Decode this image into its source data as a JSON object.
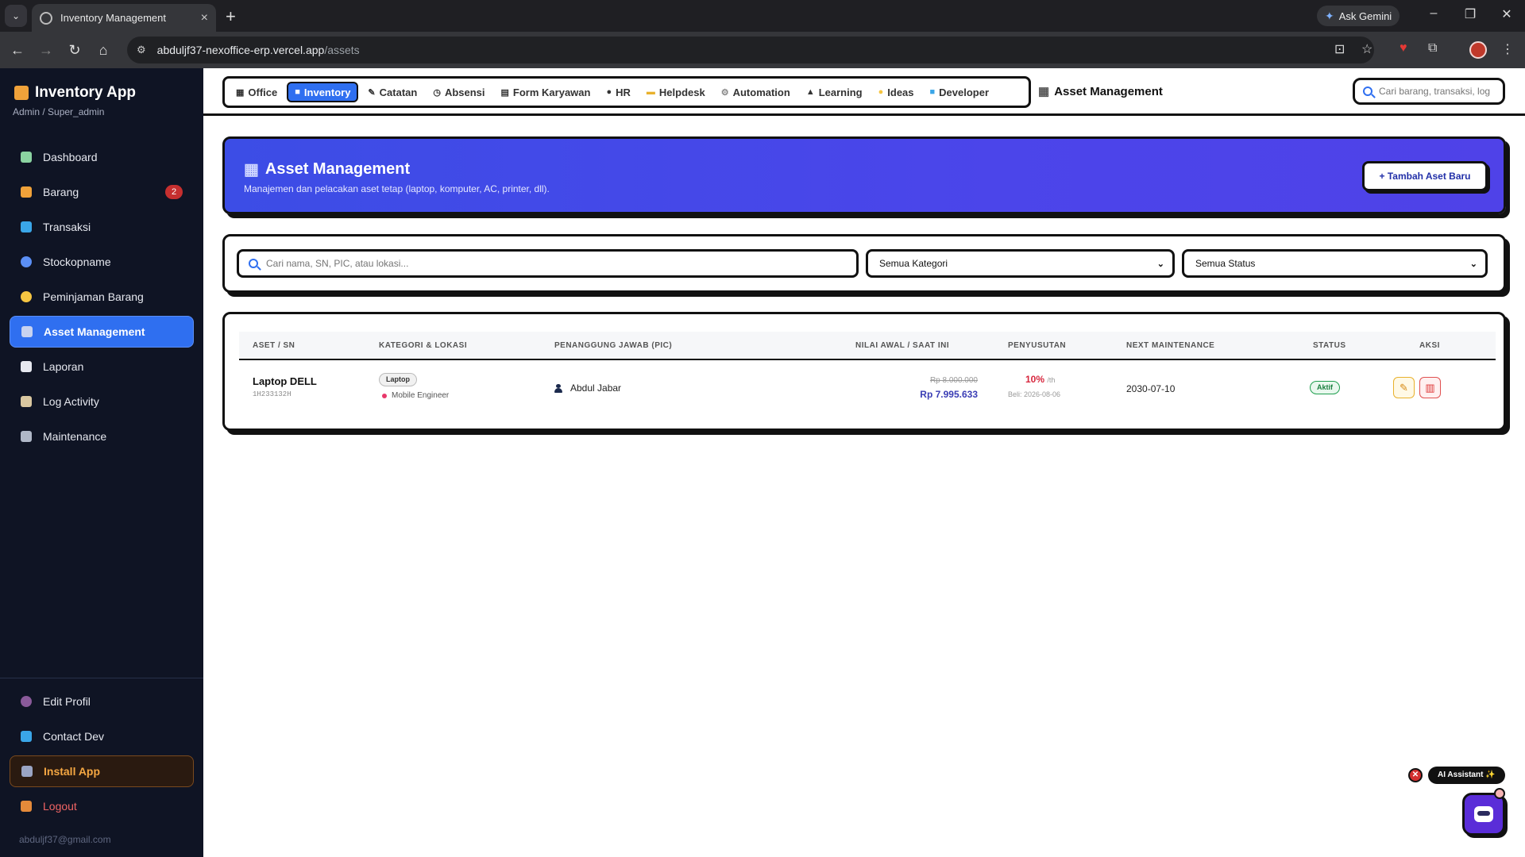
{
  "browser": {
    "tab_title": "Inventory Management",
    "new_tab": "+",
    "gemini_label": "Ask Gemini",
    "url_host": "abduljf37-nexoffice-erp.vercel.app",
    "url_path": "/assets"
  },
  "sidebar": {
    "app_title": "Inventory App",
    "role": "Admin / Super_admin",
    "items": [
      {
        "label": "Dashboard",
        "icon": "dashboard-icon",
        "color": "#8bd3a1"
      },
      {
        "label": "Barang",
        "icon": "box-icon",
        "color": "#f0a23a",
        "badge": "2"
      },
      {
        "label": "Transaksi",
        "icon": "swap-icon",
        "color": "#3aa6e8"
      },
      {
        "label": "Stockopname",
        "icon": "search-icon",
        "color": "#5b8ff5"
      },
      {
        "label": "Peminjaman Barang",
        "icon": "handshake-icon",
        "color": "#f5c542"
      },
      {
        "label": "Asset Management",
        "icon": "building-icon",
        "color": "#c7d2f0",
        "active": true
      },
      {
        "label": "Laporan",
        "icon": "document-icon",
        "color": "#e6e8ef"
      },
      {
        "label": "Log Activity",
        "icon": "clipboard-icon",
        "color": "#d9c7a0"
      },
      {
        "label": "Maintenance",
        "icon": "tools-icon",
        "color": "#b0b8c8"
      }
    ],
    "bottom": [
      {
        "label": "Edit Profil",
        "icon": "user-icon",
        "color": "#8a5a9a"
      },
      {
        "label": "Contact Dev",
        "icon": "info-icon",
        "color": "#3aa6e8"
      },
      {
        "label": "Install App",
        "icon": "install-icon",
        "color": "#9aa5c4"
      },
      {
        "label": "Logout",
        "icon": "door-icon",
        "color": "#e58a3a"
      }
    ],
    "email": "abduljf37@gmail.com"
  },
  "modules": [
    {
      "label": "Office",
      "icon": "building-icon"
    },
    {
      "label": "Inventory",
      "icon": "box-icon",
      "active": true
    },
    {
      "label": "Catatan",
      "icon": "memo-icon"
    },
    {
      "label": "Absensi",
      "icon": "clock-icon"
    },
    {
      "label": "Form Karyawan",
      "icon": "form-icon"
    },
    {
      "label": "HR",
      "icon": "user-icon"
    },
    {
      "label": "Helpdesk",
      "icon": "ticket-icon"
    },
    {
      "label": "Automation",
      "icon": "gear-icon"
    },
    {
      "label": "Learning",
      "icon": "graduation-cap-icon"
    },
    {
      "label": "Ideas",
      "icon": "lightbulb-icon"
    },
    {
      "label": "Developer",
      "icon": "book-icon"
    }
  ],
  "header": {
    "page_title": "Asset Management",
    "search_placeholder": "Cari barang, transaksi, log..."
  },
  "hero": {
    "title": "Asset Management",
    "subtitle": "Manajemen dan pelacakan aset tetap (laptop, komputer, AC, printer, dll).",
    "add_button": "+ Tambah Aset Baru"
  },
  "filters": {
    "search_placeholder": "Cari nama, SN, PIC, atau lokasi...",
    "category_value": "Semua Kategori",
    "status_value": "Semua Status"
  },
  "table": {
    "columns": [
      "ASET / SN",
      "KATEGORI & LOKASI",
      "PENANGGUNG JAWAB (PIC)",
      "NILAI AWAL / SAAT INI",
      "PENYUSUTAN",
      "NEXT MAINTENANCE",
      "STATUS",
      "AKSI"
    ],
    "rows": [
      {
        "name": "Laptop DELL",
        "sn": "1H233132H",
        "category": "Laptop",
        "location": "Mobile Engineer",
        "pic": "Abdul Jabar",
        "initial_value": "Rp 8.000.000",
        "current_value": "Rp 7.995.633",
        "depreciation": "10%",
        "depreciation_unit": "/th",
        "purchase": "Beli: 2026-08-06",
        "next_maintenance": "2030-07-10",
        "status": "Aktif"
      }
    ]
  },
  "assistant": {
    "label": "AI Assistant ✨",
    "close": "✕"
  },
  "colors": {
    "accent": "#2f6ff0",
    "sidebar_bg": "#0f1424",
    "hero_gradient": "#4b45ea",
    "status_green": "#1a7f3f",
    "danger": "#d7263d"
  }
}
